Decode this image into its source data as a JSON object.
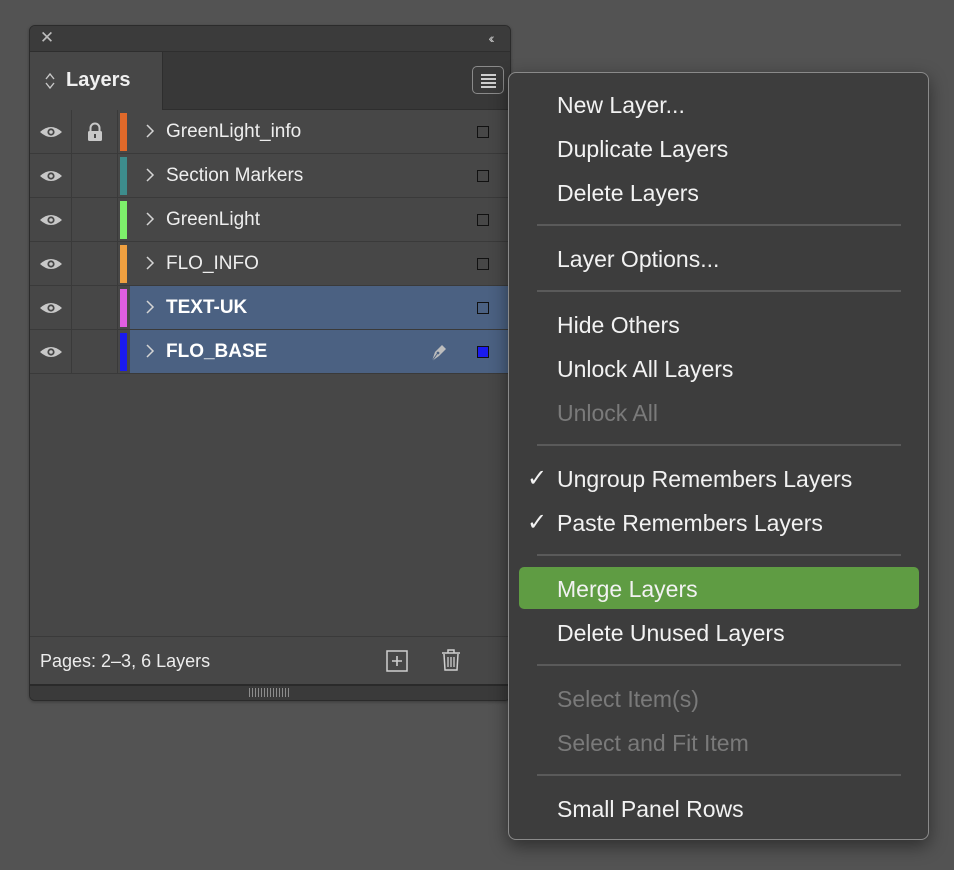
{
  "panel": {
    "close_glyph": "✕",
    "collapse_glyph": "‹‹",
    "tab_title": "Layers",
    "tab_icon": "sort-arrows-icon",
    "menu_button_icon": "panel-menu-icon"
  },
  "layers": [
    {
      "name": "GreenLight_info",
      "color": "#e0692a",
      "visible": true,
      "locked": true,
      "selected": false,
      "has_pen": false,
      "box_filled": false
    },
    {
      "name": "Section Markers",
      "color": "#3d8c8c",
      "visible": true,
      "locked": false,
      "selected": false,
      "has_pen": false,
      "box_filled": false
    },
    {
      "name": "GreenLight",
      "color": "#7df06b",
      "visible": true,
      "locked": false,
      "selected": false,
      "has_pen": false,
      "box_filled": false
    },
    {
      "name": "FLO_INFO",
      "color": "#f0a040",
      "visible": true,
      "locked": false,
      "selected": false,
      "has_pen": false,
      "box_filled": false
    },
    {
      "name": "TEXT-UK",
      "color": "#e05ee0",
      "visible": true,
      "locked": false,
      "selected": true,
      "has_pen": false,
      "box_filled": false
    },
    {
      "name": "FLO_BASE",
      "color": "#1a1aee",
      "visible": true,
      "locked": false,
      "selected": true,
      "has_pen": true,
      "box_filled": true
    }
  ],
  "footer": {
    "status": "Pages: 2–3, 6 Layers",
    "add_icon": "new-layer-icon",
    "delete_icon": "trash-icon"
  },
  "menu": {
    "items": [
      {
        "label": "New Layer...",
        "enabled": true,
        "checked": false,
        "highlighted": false
      },
      {
        "label": "Duplicate Layers",
        "enabled": true,
        "checked": false,
        "highlighted": false
      },
      {
        "label": "Delete Layers",
        "enabled": true,
        "checked": false,
        "highlighted": false
      },
      {
        "label": "Layer Options...",
        "enabled": true,
        "checked": false,
        "highlighted": false
      },
      {
        "label": "Hide Others",
        "enabled": true,
        "checked": false,
        "highlighted": false
      },
      {
        "label": "Unlock All Layers",
        "enabled": true,
        "checked": false,
        "highlighted": false
      },
      {
        "label": "Unlock All",
        "enabled": false,
        "checked": false,
        "highlighted": false
      },
      {
        "label": "Ungroup Remembers Layers",
        "enabled": true,
        "checked": true,
        "highlighted": false
      },
      {
        "label": "Paste Remembers Layers",
        "enabled": true,
        "checked": true,
        "highlighted": false
      },
      {
        "label": "Merge Layers",
        "enabled": true,
        "checked": false,
        "highlighted": true
      },
      {
        "label": "Delete Unused Layers",
        "enabled": true,
        "checked": false,
        "highlighted": false
      },
      {
        "label": "Select Item(s)",
        "enabled": false,
        "checked": false,
        "highlighted": false
      },
      {
        "label": "Select and Fit Item",
        "enabled": false,
        "checked": false,
        "highlighted": false
      },
      {
        "label": "Small Panel Rows",
        "enabled": true,
        "checked": false,
        "highlighted": false
      }
    ],
    "check_glyph": "✓"
  },
  "colors": {
    "selection": "#4b6182",
    "menu_highlight": "#5f9c43"
  }
}
